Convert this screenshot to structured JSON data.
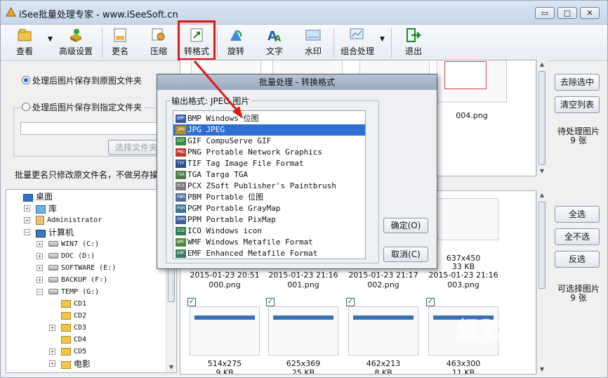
{
  "window": {
    "title": "iSee批量处理专家 - www.iSeeSoft.cn",
    "min": "▭",
    "max": "□",
    "close": "✕"
  },
  "toolbar": {
    "items": [
      {
        "label": "查看",
        "icon": "folder-open-icon"
      },
      {
        "label": "高级设置",
        "icon": "gear-box-icon"
      },
      {
        "label": "更名",
        "icon": "rename-icon"
      },
      {
        "label": "压缩",
        "icon": "compress-icon"
      },
      {
        "label": "转格式",
        "icon": "convert-format-icon"
      },
      {
        "label": "旋转",
        "icon": "rotate-icon"
      },
      {
        "label": "文字",
        "icon": "text-icon"
      },
      {
        "label": "水印",
        "icon": "watermark-icon"
      },
      {
        "label": "组合处理",
        "icon": "combo-icon"
      },
      {
        "label": "退出",
        "icon": "exit-icon"
      }
    ]
  },
  "left": {
    "opt1": "处理后图片保存到原图文件夹",
    "opt2": "处理后图片保存到指定文件夹",
    "path_value": "",
    "choose_btn": "选择文件夹",
    "rename_note": "批量更名只修改原文件名，不做另存操"
  },
  "tree": [
    {
      "label": "桌面",
      "level": 0,
      "exp": ""
    },
    {
      "label": "库",
      "level": 1,
      "exp": "+"
    },
    {
      "label": "Administrator",
      "level": 1,
      "exp": "+"
    },
    {
      "label": "计算机",
      "level": 1,
      "exp": "−"
    },
    {
      "label": "WIN7 (C:)",
      "level": 2,
      "exp": "+"
    },
    {
      "label": "DOC (D:)",
      "level": 2,
      "exp": "+"
    },
    {
      "label": "SOFTWARE (E:)",
      "level": 2,
      "exp": "+"
    },
    {
      "label": "BACKUP (F:)",
      "level": 2,
      "exp": "+"
    },
    {
      "label": "TEMP (G:)",
      "level": 2,
      "exp": "−"
    },
    {
      "label": "CD1",
      "level": 3,
      "exp": ""
    },
    {
      "label": "CD2",
      "level": 3,
      "exp": ""
    },
    {
      "label": "CD3",
      "level": 3,
      "exp": "+"
    },
    {
      "label": "CD4",
      "level": 3,
      "exp": ""
    },
    {
      "label": "CD5",
      "level": 3,
      "exp": "+"
    },
    {
      "label": "电影",
      "level": 3,
      "exp": "+"
    }
  ],
  "pending": {
    "name": "004.png",
    "remove_btn": "去除选中",
    "clear_btn": "清空列表",
    "label": "待处理图片",
    "count": "9 张"
  },
  "available": {
    "cards_row1": [
      {
        "dim": "",
        "size": "",
        "date": "2015-01-23 20:51",
        "name": "000.png"
      },
      {
        "dim": "",
        "size": "",
        "date": "2015-01-23 21:16",
        "name": "001.png"
      },
      {
        "dim": "",
        "size": "",
        "date": "2015-01-23 21:17",
        "name": "002.png"
      },
      {
        "dim": "637x450",
        "size": "33 KB",
        "date": "2015-01-23 21:16",
        "name": "003.png"
      }
    ],
    "cards_row2": [
      {
        "dim": "514x275",
        "size": "9 KB"
      },
      {
        "dim": "625x369",
        "size": "25 KB"
      },
      {
        "dim": "462x213",
        "size": "8 KB"
      },
      {
        "dim": "463x300",
        "size": "11 KB"
      }
    ],
    "all_btn": "全选",
    "none_btn": "全不选",
    "invert_btn": "反选",
    "label": "可选择图片",
    "count": "9 张"
  },
  "dialog": {
    "title": "批量处理 - 转换格式",
    "group_label": "输出格式: JPEG 图片",
    "ok": "确定(O)",
    "cancel": "取消(C)",
    "formats": [
      {
        "tag": "BMP",
        "text": "BMP Windows 位图"
      },
      {
        "tag": "JPG",
        "text": "JPG JPEG"
      },
      {
        "tag": "GIF",
        "text": "GIF CompuServe GIF"
      },
      {
        "tag": "PNG",
        "text": "PNG Protable Network Graphics"
      },
      {
        "tag": "TIF",
        "text": "TIF Tag Image File Format"
      },
      {
        "tag": "TGA",
        "text": "TGA Targa TGA"
      },
      {
        "tag": "PCX",
        "text": "PCX ZSoft Publisher's Paintbrush"
      },
      {
        "tag": "PBM",
        "text": "PBM Portable 位图"
      },
      {
        "tag": "PGM",
        "text": "PGM Portable GrayMap"
      },
      {
        "tag": "PPM",
        "text": "PPM Portable PixMap"
      },
      {
        "tag": "ICO",
        "text": "ICO Windows icon"
      },
      {
        "tag": "WMF",
        "text": "WMF Windows Metafile Format"
      },
      {
        "tag": "EMF",
        "text": "EMF Enhanced Metafile Format"
      }
    ],
    "selected_index": 1
  },
  "watermark": "经验"
}
